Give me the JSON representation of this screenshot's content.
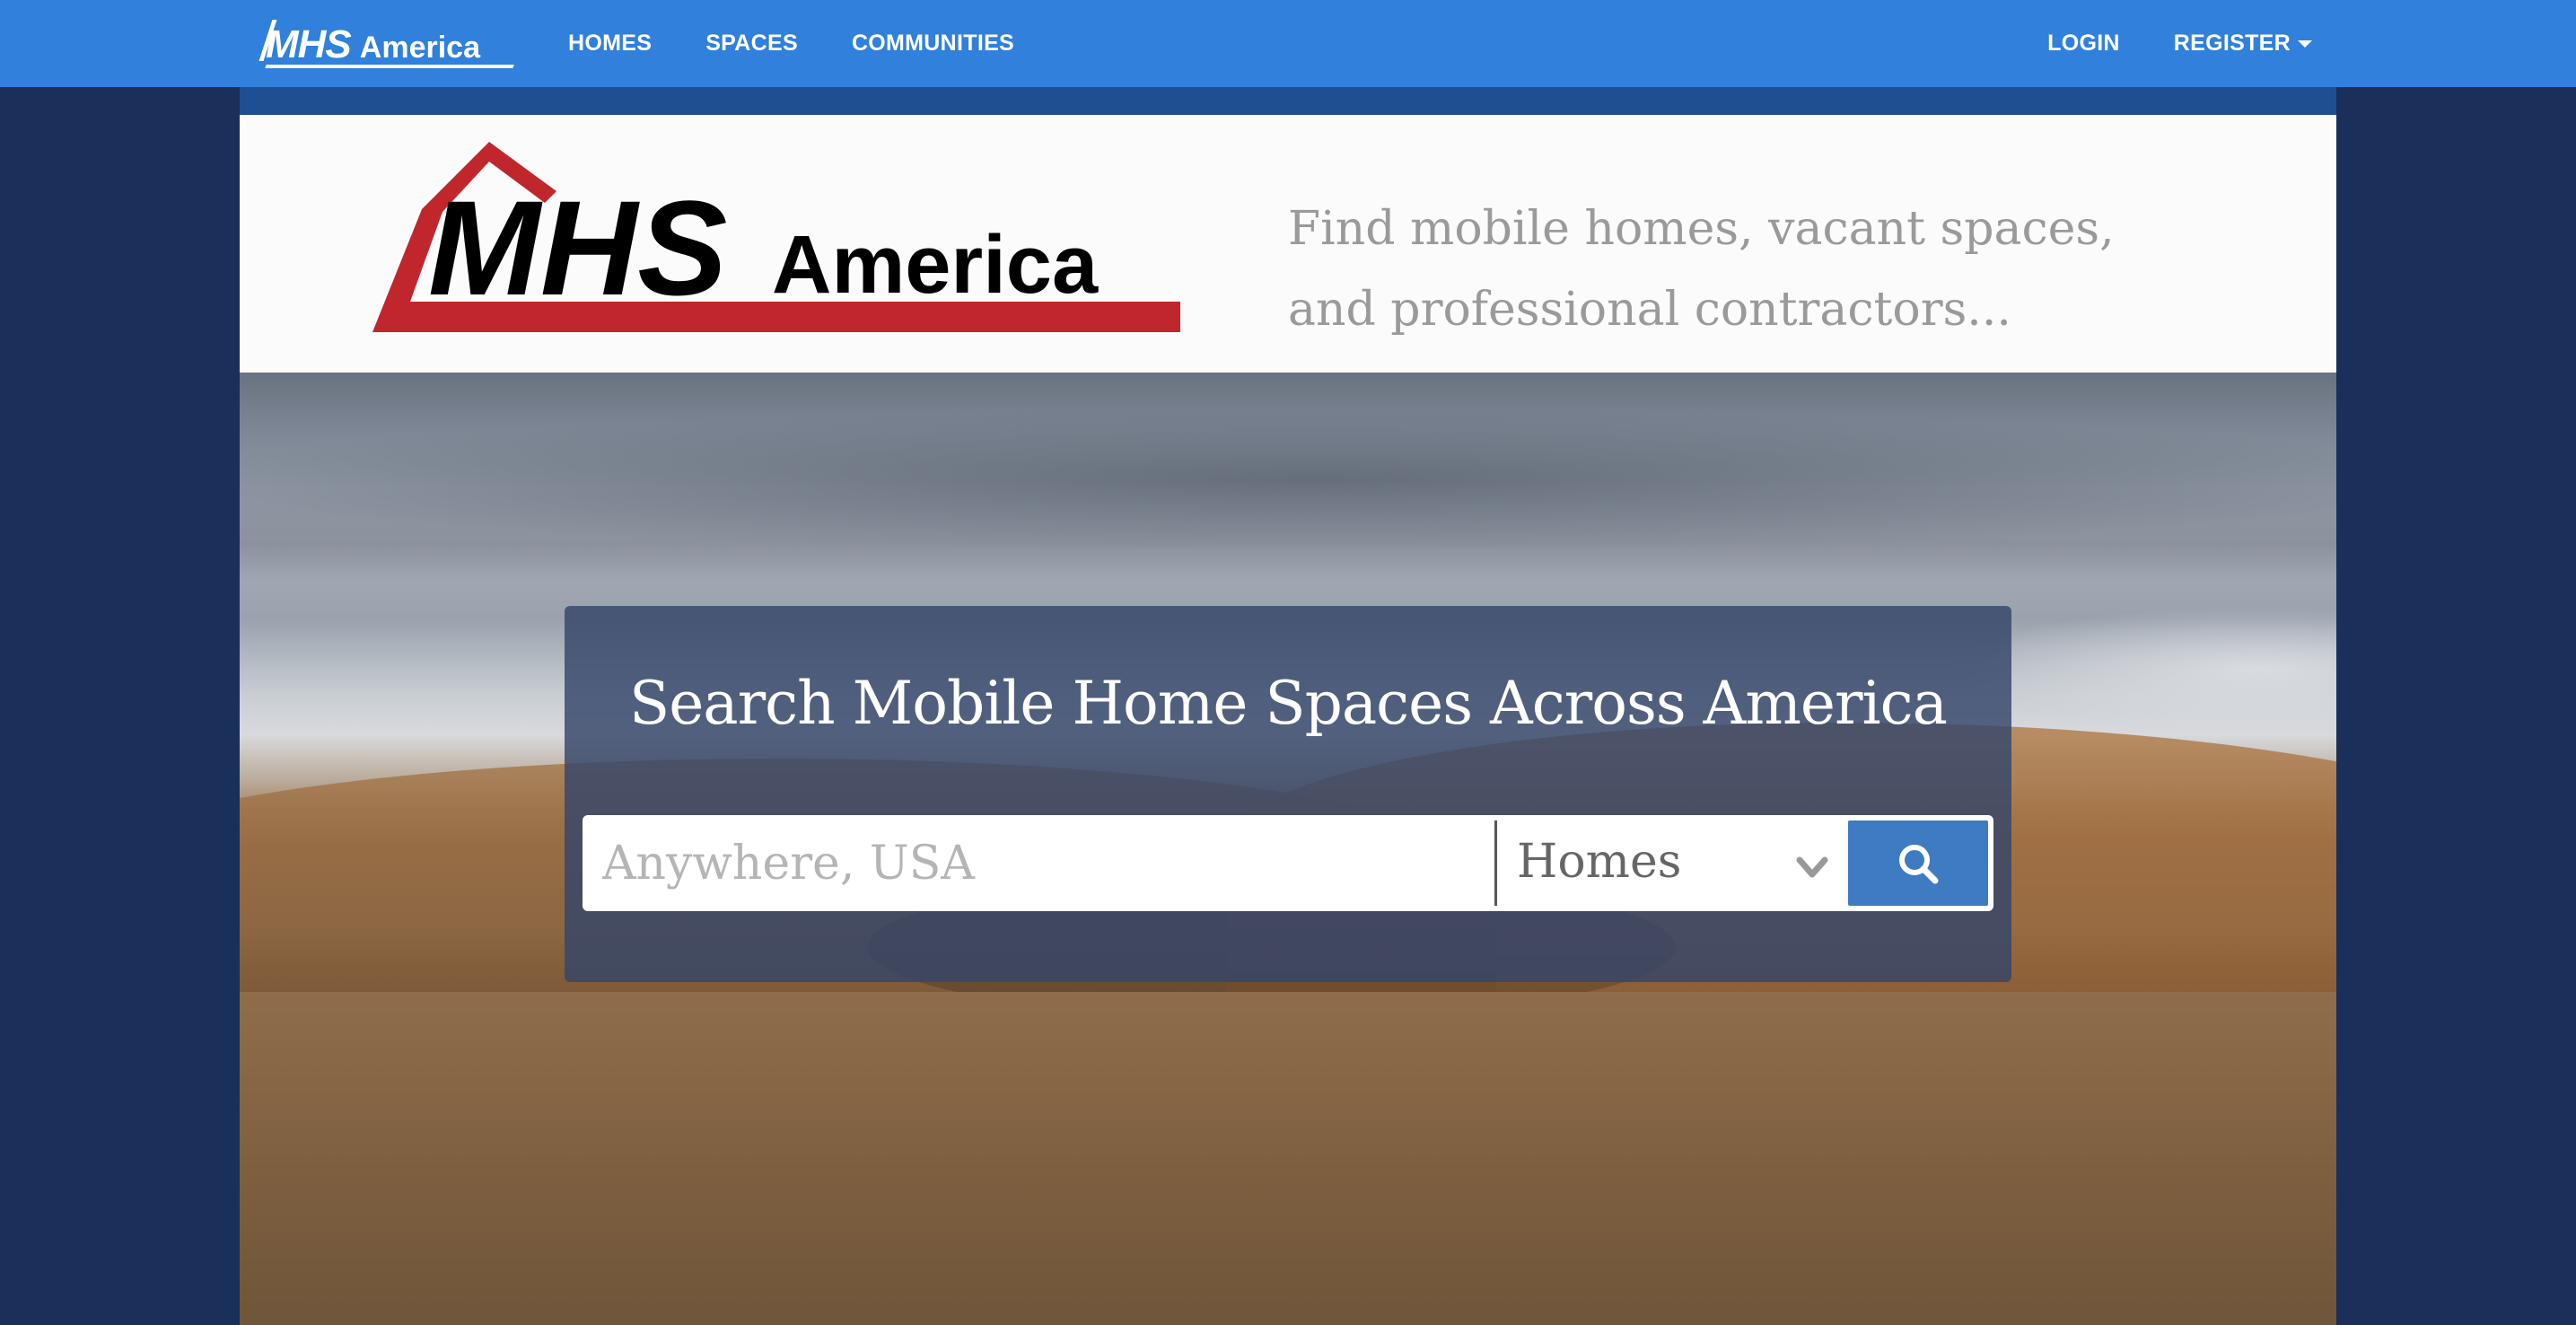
{
  "navbar": {
    "brand": {
      "mhs": "MHS",
      "america": "America"
    },
    "links": [
      {
        "label": "HOMES"
      },
      {
        "label": "SPACES"
      },
      {
        "label": "COMMUNITIES"
      }
    ],
    "right": {
      "login": "LOGIN",
      "register": "REGISTER"
    },
    "colors": {
      "bar": "#3080dc"
    }
  },
  "header": {
    "logo": {
      "mhs": "MHS",
      "america": "America",
      "roof_color": "#c0272d",
      "text_color": "#000000"
    },
    "tagline": {
      "line1": "Find mobile homes, vacant spaces,",
      "line2": "and professional contractors..."
    }
  },
  "search": {
    "title": "Search Mobile Home Spaces Across America",
    "location_placeholder": "Anywhere, USA",
    "location_value": "",
    "type_selected": "Homes",
    "button_icon": "search-icon",
    "button_color": "#3e7bc2"
  }
}
